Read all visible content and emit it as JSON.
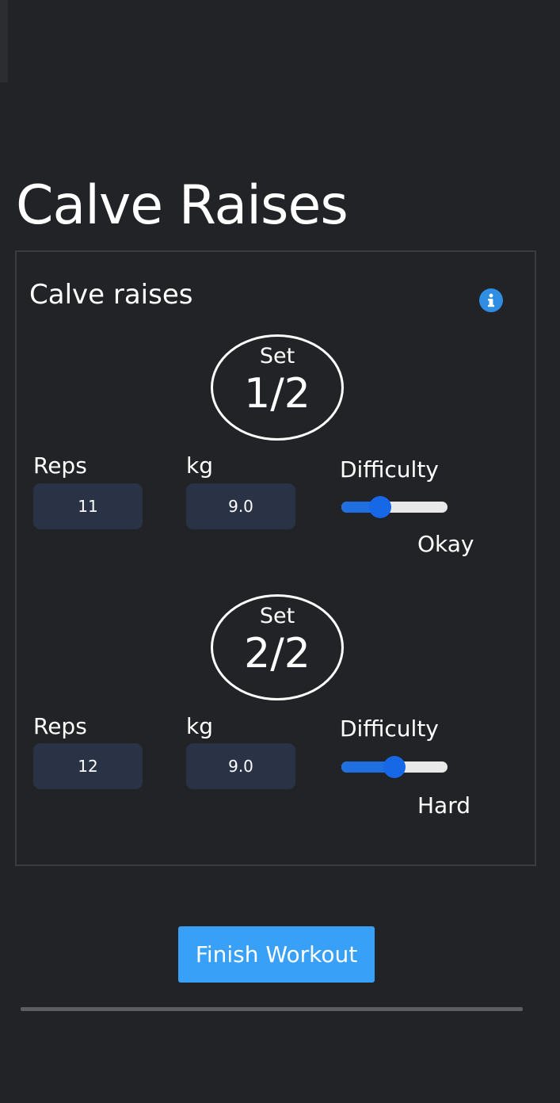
{
  "page": {
    "title": "Calve Raises"
  },
  "exercise": {
    "name": "Calve raises",
    "info_icon": "info-circle-icon",
    "sets": [
      {
        "set_label": "Set",
        "set_value": "1/2",
        "reps_label": "Reps",
        "reps_value": "11",
        "weight_label": "kg",
        "weight_value": "9.0",
        "difficulty_label": "Difficulty",
        "difficulty_level": 0.33,
        "difficulty_value": "Okay"
      },
      {
        "set_label": "Set",
        "set_value": "2/2",
        "reps_label": "Reps",
        "reps_value": "12",
        "weight_label": "kg",
        "weight_value": "9.0",
        "difficulty_label": "Difficulty",
        "difficulty_level": 0.5,
        "difficulty_value": "Hard"
      }
    ]
  },
  "actions": {
    "finish_label": "Finish Workout"
  },
  "colors": {
    "background": "#212327",
    "accent": "#38a0f6",
    "slider": "#1768e6",
    "input_bg": "#2a3346"
  }
}
